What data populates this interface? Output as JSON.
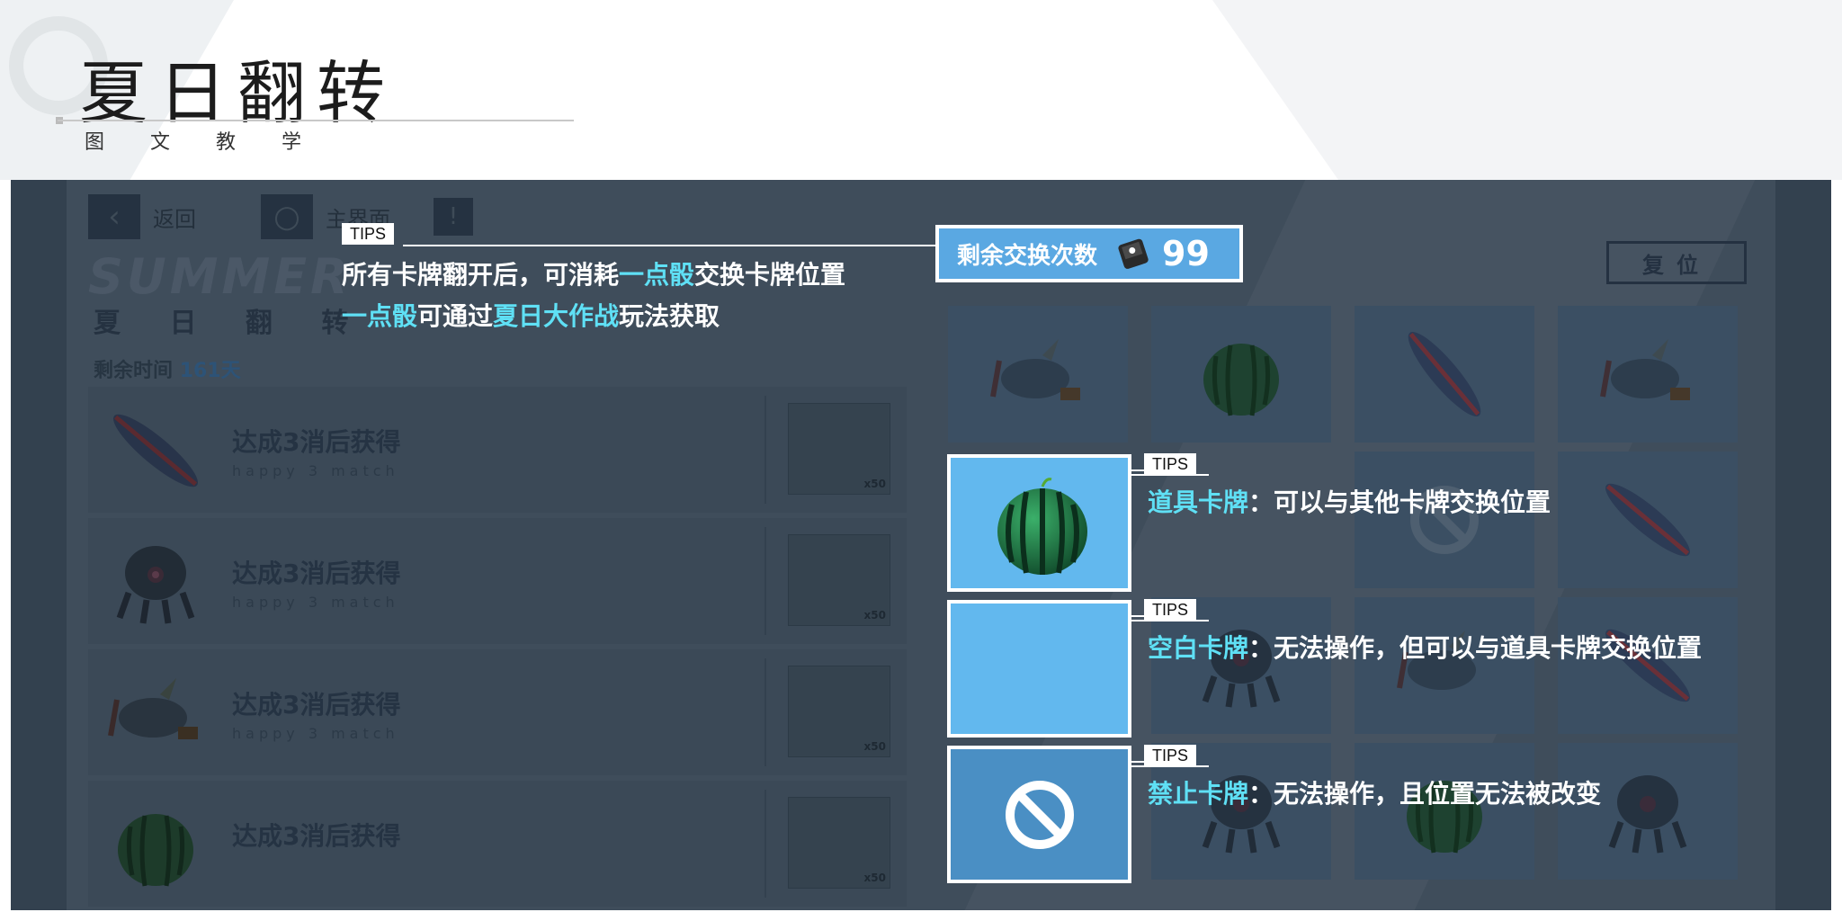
{
  "header": {
    "title": "夏日翻转",
    "subtitle": "图 文 教 学"
  },
  "game": {
    "nav": {
      "back_label": "返回",
      "home_label": "主界面"
    },
    "title_en": "SUMMER",
    "title_cn": "夏 日 翻 转",
    "time_label": "剩余时间",
    "time_value": "161天",
    "reset_label": "复位",
    "rows": [
      {
        "item": "surfboard-icon",
        "label": "达成3消后获得",
        "sub": "happy 3 match",
        "reward_count": "x50"
      },
      {
        "item": "robot-icon",
        "label": "达成3消后获得",
        "sub": "happy 3 match",
        "reward_count": "x50"
      },
      {
        "item": "fish-icon",
        "label": "达成3消后获得",
        "sub": "happy 3 match",
        "reward_count": "x50"
      },
      {
        "item": "watermelon-icon",
        "label": "达成3消后获得",
        "sub": "",
        "reward_count": "x50"
      }
    ],
    "grid": [
      {
        "item": "fish-icon"
      },
      {
        "item": "watermelon-icon"
      },
      {
        "item": "surfboard-icon"
      },
      {
        "item": "fish-icon"
      },
      {
        "item": "forbidden-icon"
      },
      {
        "item": "surfboard-icon"
      },
      {
        "item": "robot-icon"
      },
      {
        "item": "fish-icon"
      },
      {
        "item": "surfboard-icon"
      },
      {
        "item": "robot-icon"
      },
      {
        "item": "watermelon-icon"
      },
      {
        "item": "robot-icon"
      }
    ]
  },
  "counter": {
    "label": "剩余交换次数",
    "icon": "dice-icon",
    "value": "99"
  },
  "tips": {
    "tag": "TIPS",
    "main": {
      "line1": {
        "a": "所有卡牌翻开后，可消耗",
        "b": "一点骰",
        "c": "交换卡牌位置"
      },
      "line2": {
        "a": "一点骰",
        "b": "可通过",
        "c": "夏日大作战",
        "d": "玩法获取"
      }
    },
    "cards": [
      {
        "icon": "watermelon-icon",
        "name": "道具卡牌",
        "desc": "：可以与其他卡牌交换位置"
      },
      {
        "icon": "",
        "name": "空白卡牌",
        "desc": "：无法操作，但可以与道具卡牌交换位置"
      },
      {
        "icon": "forbidden-icon",
        "name": "禁止卡牌",
        "desc": "：无法操作，且位置无法被改变"
      }
    ]
  },
  "colors": {
    "highlight": "#5fe0f5",
    "card_blue": "#62b8ee",
    "counter_blue": "#5aa8e2",
    "dim_bg": "#3f4d5b"
  }
}
